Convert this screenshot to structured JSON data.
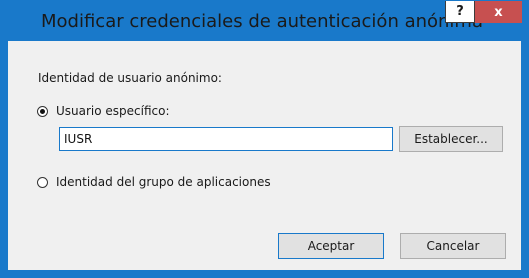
{
  "dialog": {
    "title": "Modificar credenciales de autenticación anónima",
    "help_label": "?",
    "close_label": "x"
  },
  "form": {
    "group_label": "Identidad de usuario anónimo:",
    "option_specific_user": "Usuario específico:",
    "username_value": "IUSR",
    "set_button": "Establecer...",
    "option_app_pool": "Identidad del grupo de aplicaciones",
    "selected_option": "Usuario específico:"
  },
  "footer": {
    "ok_button": "Aceptar",
    "cancel_button": "Cancelar"
  },
  "colors": {
    "title_bar": "#1979ca",
    "close_button": "#c75050",
    "content_background": "#f0f0f0"
  }
}
